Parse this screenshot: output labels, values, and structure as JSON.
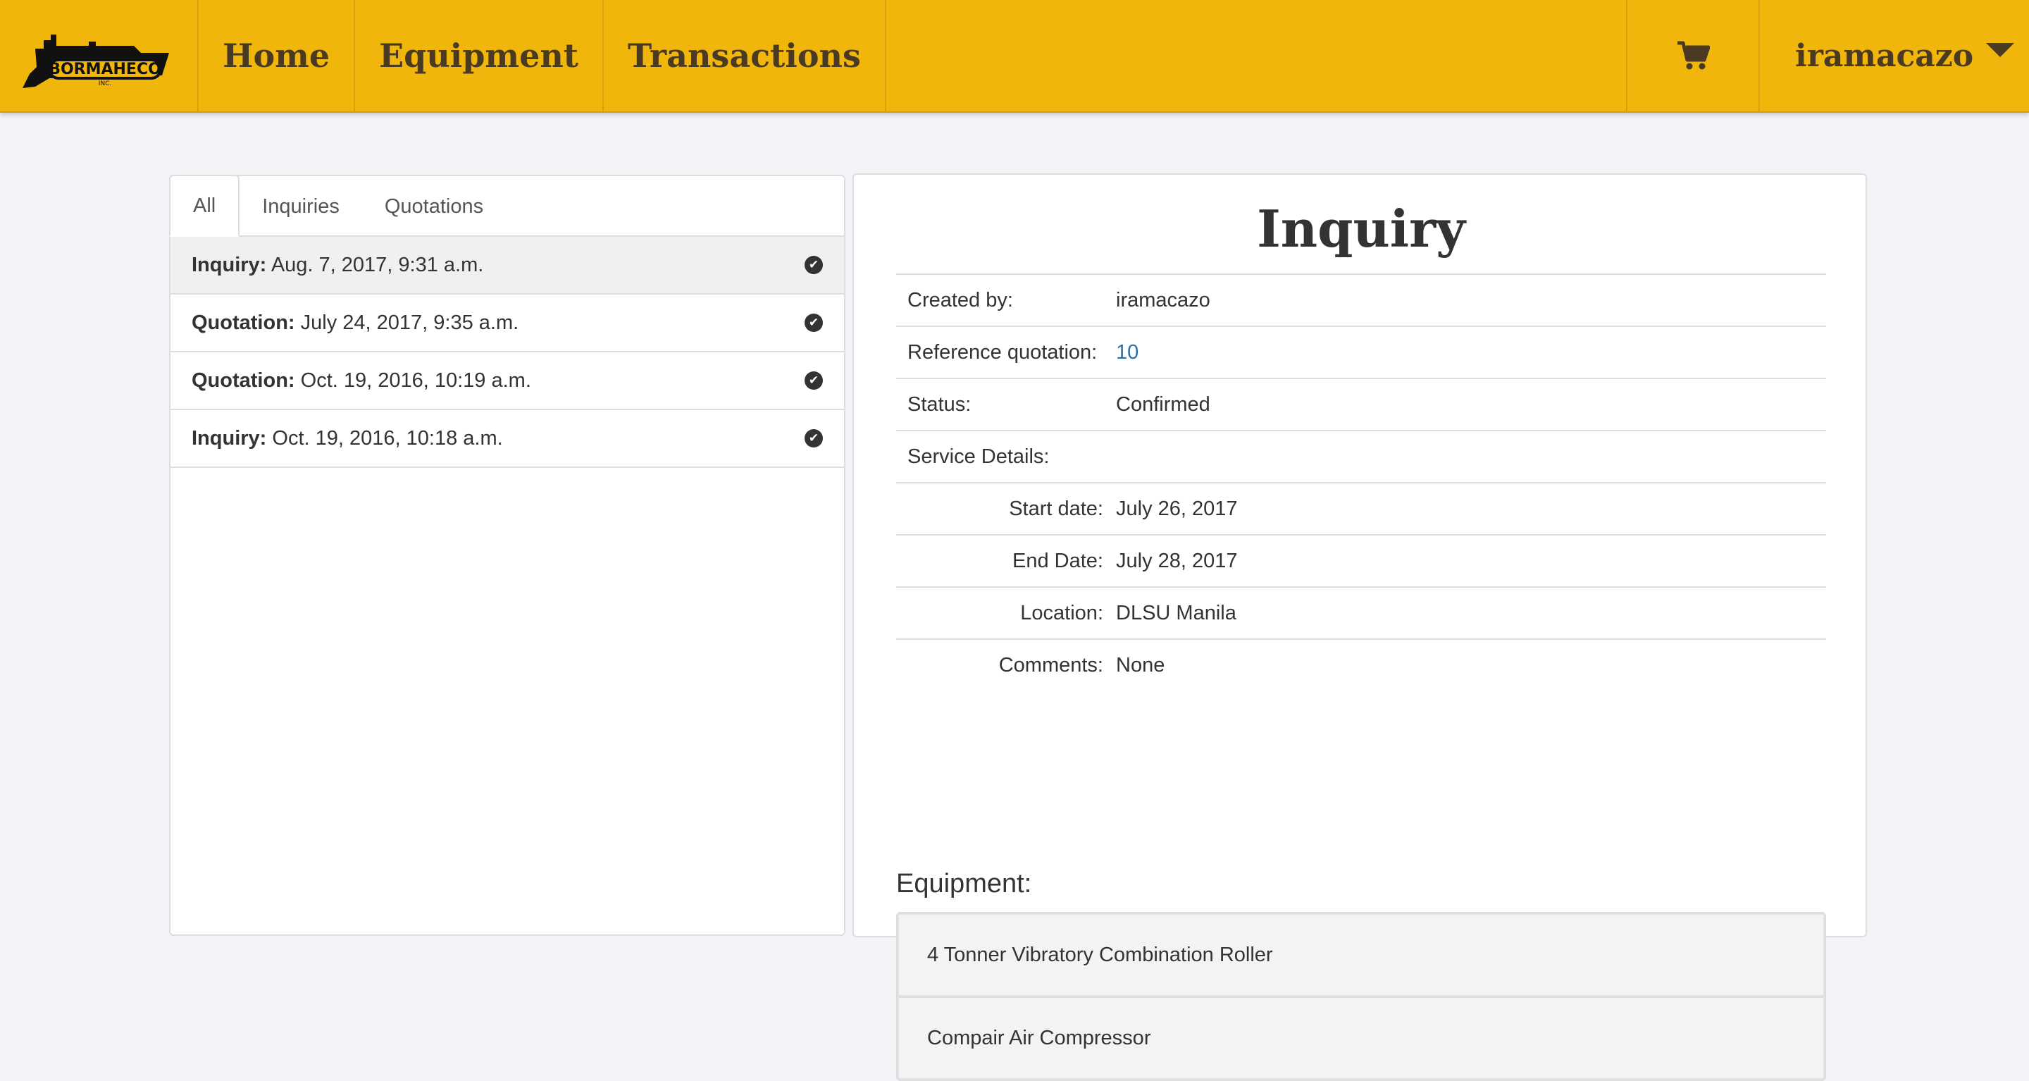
{
  "nav": {
    "brand_logo": "BORMAHECO",
    "links": [
      "Home",
      "Equipment",
      "Transactions"
    ],
    "cart_icon": "shopping-cart-icon",
    "username": "iramacazo"
  },
  "tabs": [
    "All",
    "Inquiries",
    "Quotations"
  ],
  "active_tab": "All",
  "transactions": [
    {
      "type": "Inquiry:",
      "date": "Aug. 7, 2017, 9:31 a.m.",
      "selected": true
    },
    {
      "type": "Quotation:",
      "date": "July 24, 2017, 9:35 a.m."
    },
    {
      "type": "Quotation:",
      "date": "Oct. 19, 2016, 10:19 a.m."
    },
    {
      "type": "Inquiry:",
      "date": "Oct. 19, 2016, 10:18 a.m."
    }
  ],
  "detail": {
    "title": "Inquiry",
    "created_by_label": "Created by:",
    "created_by": "iramacazo",
    "reference_label": "Reference quotation:",
    "reference": "10",
    "status_label": "Status:",
    "status": "Confirmed",
    "service_label": "Service Details:",
    "start_label": "Start date:",
    "start": "July 26, 2017",
    "end_label": "End Date:",
    "end": "July 28, 2017",
    "location_label": "Location:",
    "location": "DLSU Manila",
    "comments_label": "Comments:",
    "comments": "None",
    "equipment_heading": "Equipment:",
    "equipment": [
      "4 Tonner Vibratory Combination Roller",
      "Compair Air Compressor"
    ]
  },
  "colors": {
    "navbar": "#f1b60c",
    "link": "#2a6fa8"
  }
}
